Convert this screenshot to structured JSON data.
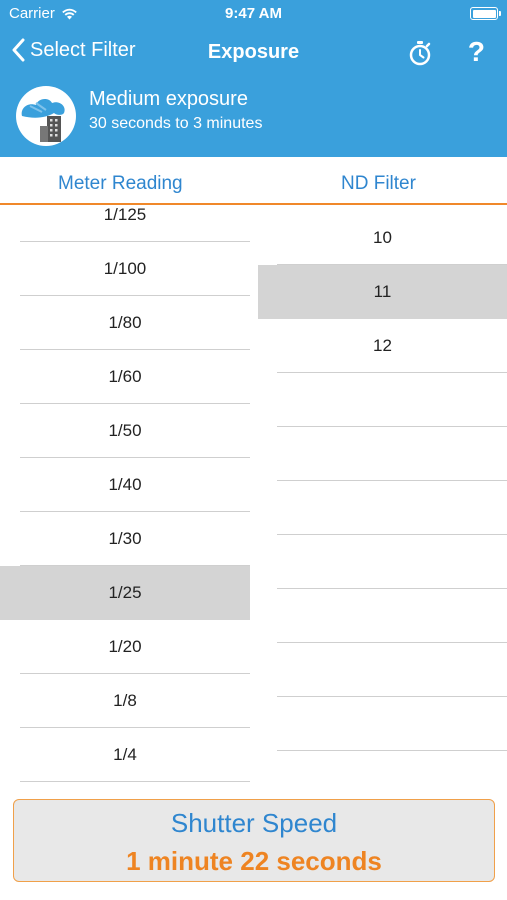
{
  "status_bar": {
    "carrier": "Carrier",
    "time": "9:47 AM"
  },
  "nav": {
    "back_label": "Select Filter",
    "title": "Exposure",
    "help_label": "?"
  },
  "filter": {
    "name": "Medium exposure",
    "description": "30 seconds to 3 minutes"
  },
  "tabs": {
    "meter_reading": "Meter Reading",
    "nd_filter": "ND Filter"
  },
  "meter_readings": [
    "1/125",
    "1/100",
    "1/80",
    "1/60",
    "1/50",
    "1/40",
    "1/30",
    "1/25",
    "1/20",
    "1/8",
    "1/4"
  ],
  "meter_selected": "1/25",
  "nd_filters": [
    "10",
    "11",
    "12"
  ],
  "nd_selected": "11",
  "result": {
    "label": "Shutter Speed",
    "value": "1 minute 22 seconds"
  },
  "colors": {
    "brand_blue": "#3aa0dc",
    "accent_orange": "#f0882a",
    "link_blue": "#2f86cf",
    "selected_gray": "#d4d4d4"
  }
}
